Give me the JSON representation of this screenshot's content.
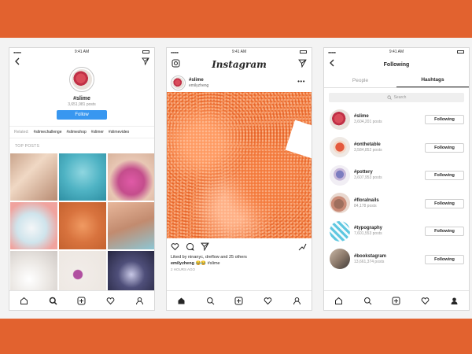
{
  "colors": {
    "accent": "#e2622f",
    "link_blue": "#3897f0",
    "border": "#d8d8d8"
  },
  "status": {
    "time": "9:41 AM"
  },
  "screen1": {
    "hashtag": "#slime",
    "posts": "3,651,981 posts",
    "follow_label": "Follow",
    "related_label": "Related:",
    "related_tags": [
      "#slimechallenge",
      "#slimeshop",
      "#slimer",
      "#slimevideo"
    ],
    "top_posts_label": "TOP POSTS"
  },
  "screen2": {
    "logo": "Instagram",
    "post_tag": "#slime",
    "post_user": "emilyzheng",
    "liked_by": "Liked by ninanyc, dreflow and 25 others",
    "caption_user": "emilyzheng",
    "caption_text": "😂😂 #slime",
    "time_ago": "2 HOURS AGO"
  },
  "screen3": {
    "title": "Following",
    "tabs": [
      "People",
      "Hashtags"
    ],
    "active_tab": "Hashtags",
    "search_placeholder": "Search",
    "button_label": "Following",
    "rows": [
      {
        "tag": "#slime",
        "count": "3,604,201 posts"
      },
      {
        "tag": "#onthetable",
        "count": "3,584,852 posts"
      },
      {
        "tag": "#pottery",
        "count": "3,607,953 posts"
      },
      {
        "tag": "#floralnails",
        "count": "84,178 posts"
      },
      {
        "tag": "#typography",
        "count": "7,601,553 posts"
      },
      {
        "tag": "#bookstagram",
        "count": "13,661,374 posts"
      }
    ]
  }
}
